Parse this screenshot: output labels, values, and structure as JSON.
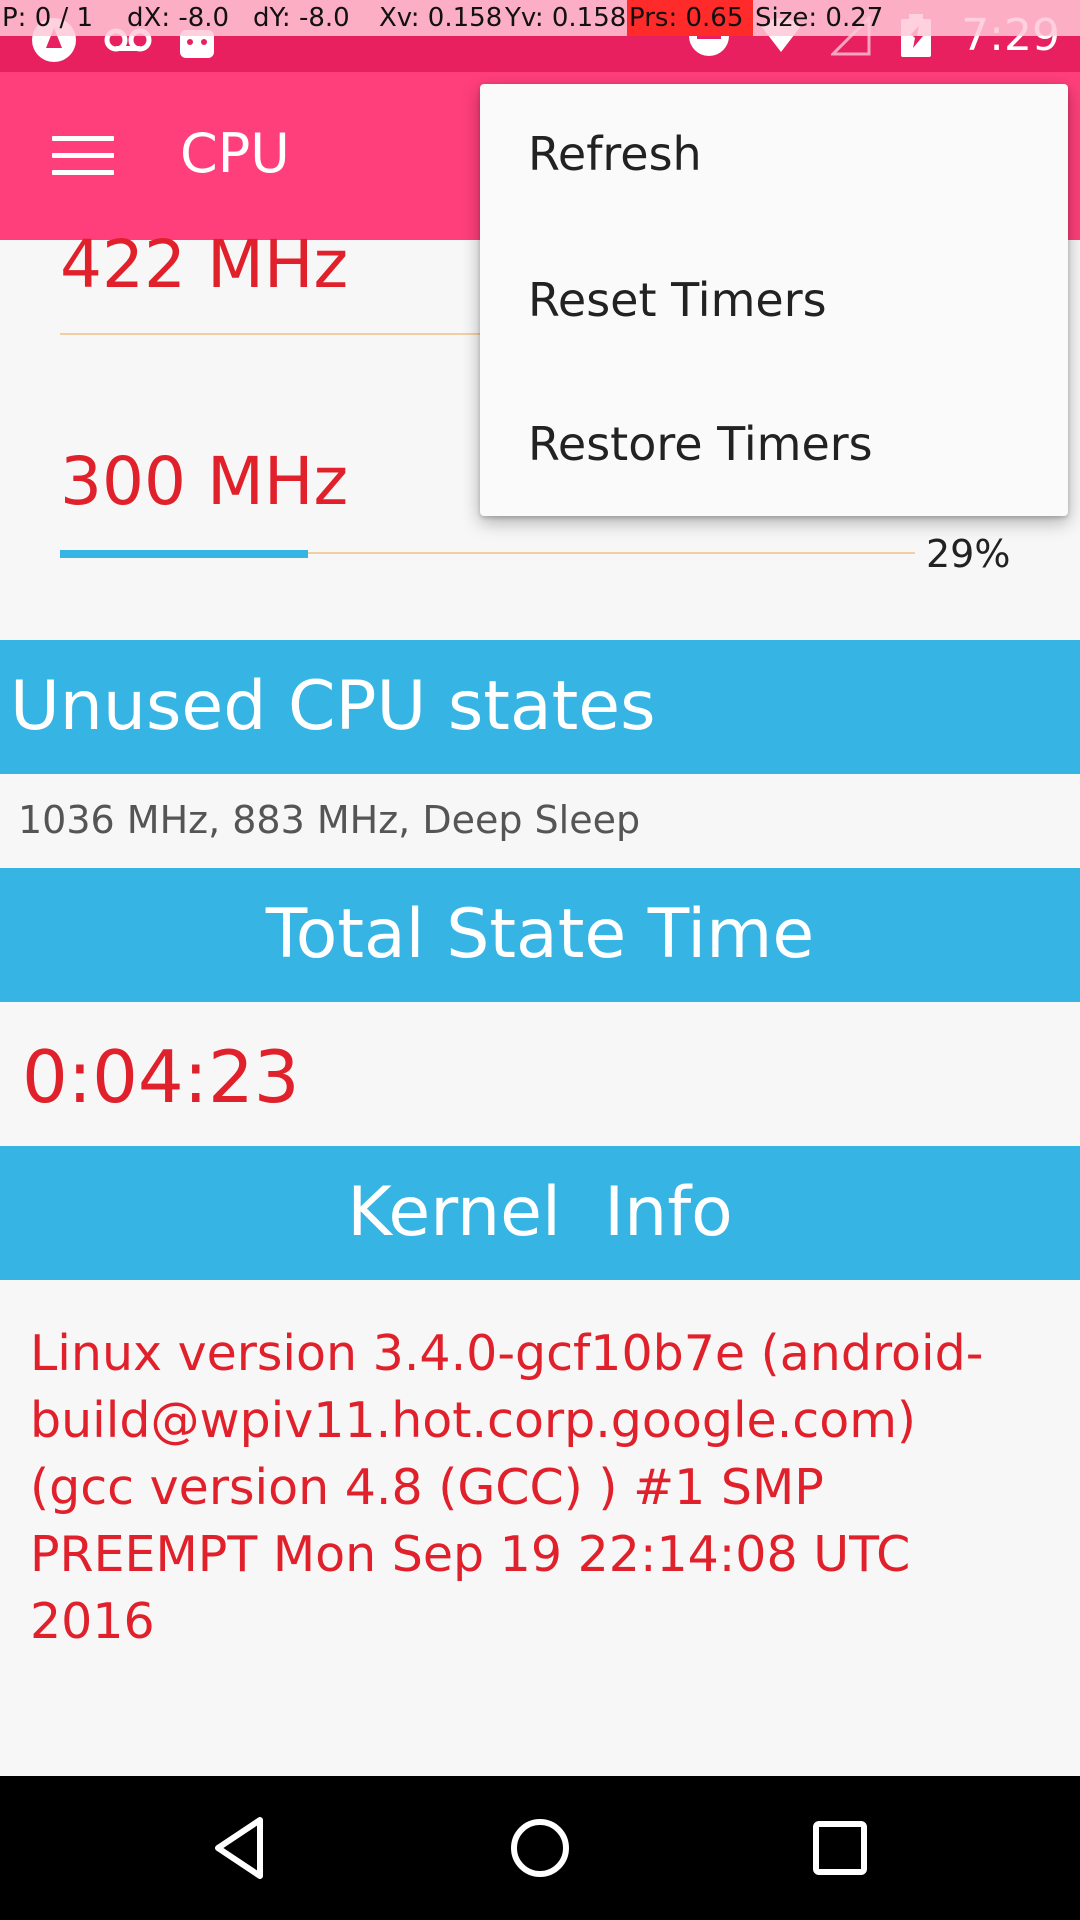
{
  "debug_overlay": {
    "pointer": "P: 0 / 1",
    "dx": "dX: -8.0",
    "dy": "dY: -8.0",
    "xv": "Xv: 0.158",
    "yv": "Yv: 0.158",
    "prs": "Prs: 0.65",
    "size": "Size: 0.27"
  },
  "status_bar": {
    "time": "7:29"
  },
  "app_bar": {
    "title": "CPU"
  },
  "cpu_states": [
    {
      "freq": "422 MHz"
    },
    {
      "freq": "300 MHz",
      "percent_text": "29%",
      "percent": 0.29
    }
  ],
  "unused": {
    "header": "Unused CPU states",
    "text": "1036 MHz, 883 MHz, Deep Sleep"
  },
  "total": {
    "header": "Total State Time",
    "time": "0:04:23"
  },
  "kernel": {
    "header": "Kernel  Info",
    "text": "Linux version 3.4.0-gcf10b7e (android-build@wpiv11.hot.corp.google.com) (gcc version 4.8 (GCC) ) #1 SMP PREEMPT Mon Sep 19 22:14:08 UTC 2016"
  },
  "menu": {
    "items": [
      "Refresh",
      "Reset Timers",
      "Restore Timers"
    ]
  },
  "colors": {
    "status_bar": "#e8205f",
    "app_bar": "#ff3f7b",
    "section": "#36b4e4",
    "value_text": "#e0202a",
    "bar_fill": "#36b4e4",
    "bar_track": "#f2cfa3"
  }
}
